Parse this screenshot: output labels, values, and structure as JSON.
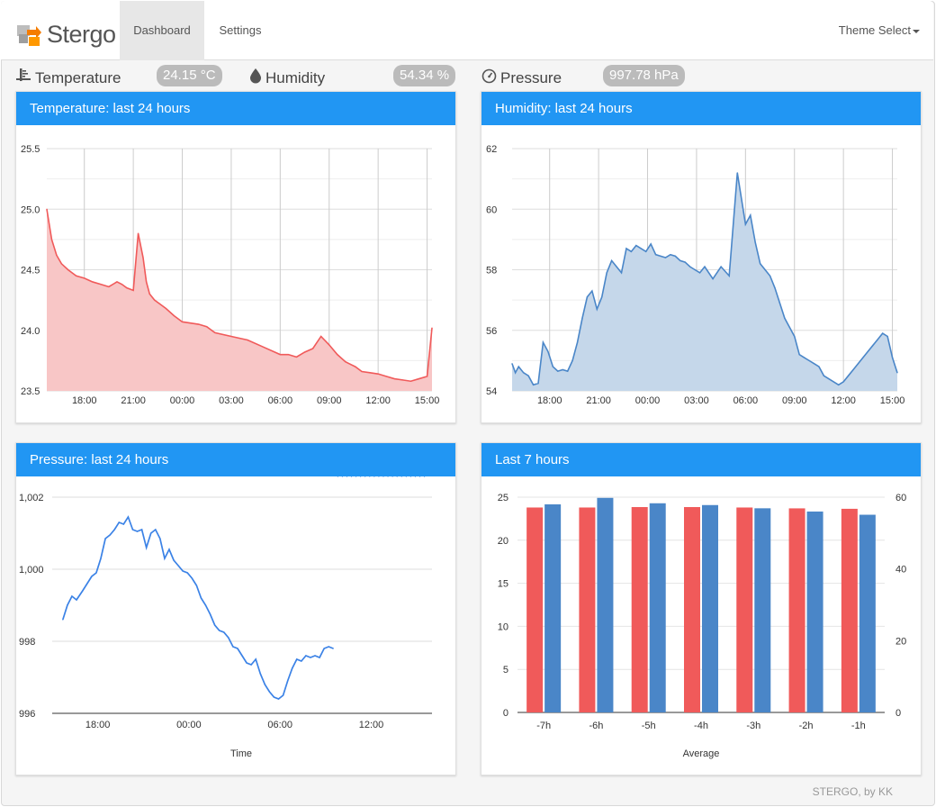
{
  "navbar": {
    "brand": "Stergo",
    "tabs": [
      {
        "label": "Dashboard",
        "active": true
      },
      {
        "label": "Settings",
        "active": false
      }
    ],
    "theme_select": "Theme Select"
  },
  "stats": {
    "temperature": {
      "label": "Temperature",
      "value": "24.15 °C",
      "icon": "thermometer-icon"
    },
    "humidity": {
      "label": "Humidity",
      "value": "54.34 %",
      "icon": "water-drop-icon"
    },
    "pressure": {
      "label": "Pressure",
      "value": "997.78 hPa",
      "icon": "gauge-icon"
    }
  },
  "cards": {
    "temperature": {
      "title": "Temperature: last 24 hours"
    },
    "humidity": {
      "title": "Humidity: last 24 hours"
    },
    "pressure": {
      "title": "Pressure: last 24 hours"
    },
    "last7": {
      "title": "Last 7 hours"
    }
  },
  "footer": "STERGO, by KK",
  "colors": {
    "accent": "#2196f3",
    "temperature": "#f05a5a",
    "humidity": "#4a86c8",
    "pressure": "#3b82e6"
  },
  "chart_data": [
    {
      "type": "area",
      "title": "Temperature: last 24 hours",
      "x": [
        15.7,
        16.0,
        16.3,
        16.6,
        17.0,
        17.5,
        18.0,
        18.5,
        19.0,
        19.5,
        20.0,
        20.3,
        20.6,
        21.0,
        21.3,
        21.6,
        21.8,
        22.0,
        22.3,
        22.6,
        23.0,
        23.5,
        24.0,
        24.5,
        25.0,
        25.5,
        26.0,
        27.0,
        28.0,
        29.0,
        30.0,
        30.5,
        31.0,
        31.5,
        32.0,
        32.5,
        33.0,
        33.5,
        34.0,
        34.3,
        34.6,
        35.0,
        35.5,
        36.0,
        36.5,
        37.0,
        37.5,
        38.0,
        38.5,
        39.0,
        39.3
      ],
      "y": [
        25.0,
        24.75,
        24.62,
        24.55,
        24.5,
        24.45,
        24.43,
        24.4,
        24.38,
        24.36,
        24.4,
        24.38,
        24.35,
        24.33,
        24.8,
        24.6,
        24.4,
        24.3,
        24.25,
        24.22,
        24.18,
        24.12,
        24.07,
        24.06,
        24.05,
        24.03,
        23.98,
        23.95,
        23.92,
        23.86,
        23.8,
        23.8,
        23.78,
        23.82,
        23.85,
        23.95,
        23.88,
        23.8,
        23.74,
        23.72,
        23.7,
        23.66,
        23.65,
        23.64,
        23.62,
        23.6,
        23.59,
        23.58,
        23.6,
        23.62,
        24.02
      ],
      "xticks": [
        "18:00",
        "21:00",
        "00:00",
        "03:00",
        "06:00",
        "09:00",
        "12:00",
        "15:00"
      ],
      "xtick_values": [
        18,
        21,
        24,
        27,
        30,
        33,
        36,
        39
      ],
      "ylim": [
        23.5,
        25.5
      ],
      "yticks": [
        "23.5",
        "24.0",
        "24.5",
        "25.0",
        "25.5"
      ],
      "color": "#f05a5a",
      "fill": "#f8c6c6"
    },
    {
      "type": "area",
      "title": "Humidity: last 24 hours",
      "x": [
        15.7,
        15.9,
        16.1,
        16.4,
        16.7,
        17.0,
        17.3,
        17.6,
        17.9,
        18.2,
        18.5,
        18.8,
        19.1,
        19.4,
        19.7,
        20.0,
        20.3,
        20.6,
        20.9,
        21.2,
        21.5,
        21.8,
        22.1,
        22.4,
        22.7,
        23.0,
        23.3,
        23.6,
        23.9,
        24.2,
        24.5,
        24.8,
        25.1,
        25.4,
        25.7,
        26.0,
        26.3,
        26.6,
        26.9,
        27.2,
        27.5,
        28.0,
        28.5,
        29.0,
        29.5,
        30.0,
        30.3,
        30.6,
        30.9,
        31.2,
        31.5,
        31.8,
        32.1,
        32.4,
        32.7,
        33.0,
        33.3,
        33.6,
        33.9,
        34.2,
        34.5,
        34.8,
        35.1,
        35.4,
        35.7,
        36.0,
        36.3,
        36.6,
        36.9,
        37.2,
        37.5,
        37.8,
        38.1,
        38.4,
        38.7,
        39.0,
        39.3
      ],
      "y": [
        54.9,
        54.6,
        54.8,
        54.6,
        54.5,
        54.2,
        54.25,
        55.6,
        55.3,
        54.8,
        54.65,
        54.7,
        54.65,
        55.0,
        55.6,
        56.4,
        57.1,
        57.3,
        56.7,
        57.1,
        57.9,
        58.3,
        58.1,
        57.9,
        58.7,
        58.6,
        58.8,
        58.7,
        58.6,
        58.85,
        58.5,
        58.45,
        58.4,
        58.5,
        58.45,
        58.3,
        58.25,
        58.1,
        58.0,
        57.9,
        58.1,
        57.7,
        58.1,
        57.8,
        61.2,
        59.5,
        59.8,
        58.9,
        58.2,
        58.0,
        57.8,
        57.4,
        56.9,
        56.4,
        56.1,
        55.8,
        55.2,
        55.1,
        55.0,
        54.9,
        54.8,
        54.5,
        54.4,
        54.3,
        54.2,
        54.3,
        54.5,
        54.7,
        54.9,
        55.1,
        55.3,
        55.5,
        55.7,
        55.9,
        55.8,
        55.1,
        54.6
      ],
      "xticks": [
        "18:00",
        "21:00",
        "00:00",
        "03:00",
        "06:00",
        "09:00",
        "12:00",
        "15:00"
      ],
      "xtick_values": [
        18,
        21,
        24,
        27,
        30,
        33,
        36,
        39
      ],
      "ylim": [
        54,
        62
      ],
      "yticks": [
        "54",
        "56",
        "58",
        "60",
        "62"
      ],
      "color": "#4a86c8",
      "fill": "#c5d7ea"
    },
    {
      "type": "line",
      "title": "Pressure: last 24 hours",
      "xlabel": "Time",
      "x": [
        15.7,
        16.0,
        16.3,
        16.6,
        17.0,
        17.3,
        17.6,
        17.9,
        18.2,
        18.5,
        18.8,
        19.1,
        19.4,
        19.7,
        20.0,
        20.3,
        20.6,
        20.9,
        21.2,
        21.5,
        21.8,
        22.1,
        22.4,
        22.7,
        23.0,
        23.3,
        23.6,
        23.9,
        24.2,
        24.5,
        24.8,
        25.1,
        25.4,
        25.7,
        26.0,
        26.3,
        26.6,
        26.9,
        27.2,
        27.5,
        27.8,
        28.1,
        28.4,
        28.7,
        29.0,
        29.3,
        29.6,
        29.9,
        30.2,
        30.5,
        30.8,
        31.1,
        31.4,
        31.7,
        32.0,
        32.3,
        32.6,
        32.9,
        33.2,
        33.5,
        33.8,
        34.1,
        34.4,
        34.7,
        35.0,
        35.3,
        35.6,
        35.9,
        36.2,
        36.5,
        36.8,
        37.1,
        37.4,
        37.7,
        38.0,
        38.3,
        38.6,
        38.9,
        39.2,
        39.5
      ],
      "y": [
        998.6,
        999.0,
        999.25,
        999.15,
        999.4,
        999.6,
        999.8,
        999.9,
        1000.3,
        1000.85,
        1000.95,
        1001.1,
        1001.3,
        1001.25,
        1001.45,
        1001.1,
        1001.05,
        1001.1,
        1000.6,
        1001.0,
        1001.1,
        1000.85,
        1000.3,
        1000.55,
        1000.25,
        1000.1,
        999.95,
        999.9,
        999.75,
        999.55,
        999.2,
        999.0,
        998.75,
        998.45,
        998.3,
        998.25,
        998.1,
        997.85,
        997.8,
        997.6,
        997.4,
        997.35,
        997.5,
        997.1,
        996.8,
        996.6,
        996.45,
        996.4,
        996.5,
        996.9,
        997.25,
        997.5,
        997.45,
        997.6,
        997.55,
        997.6,
        997.55,
        997.8,
        997.85,
        997.8
      ]
    },
    {
      "type": "bar",
      "title": "Last 7 hours",
      "xlabel": "Average",
      "categories": [
        "-7h",
        "-6h",
        "-5h",
        "-4h",
        "-3h",
        "-2h",
        "-1h"
      ],
      "series": [
        {
          "axis": "left",
          "color": "#f05a5a",
          "values": [
            23.8,
            23.8,
            23.85,
            23.85,
            23.8,
            23.7,
            23.65
          ]
        },
        {
          "axis": "right",
          "color": "#4a86c8",
          "values": [
            58.0,
            59.8,
            58.3,
            57.8,
            56.9,
            56.0,
            55.1
          ]
        }
      ],
      "ylim_left": [
        0,
        25
      ],
      "yticks_left": [
        "0",
        "5",
        "10",
        "15",
        "20",
        "25"
      ],
      "ylim_right": [
        0,
        60
      ],
      "yticks_right": [
        "0",
        "20",
        "40",
        "60"
      ]
    }
  ]
}
